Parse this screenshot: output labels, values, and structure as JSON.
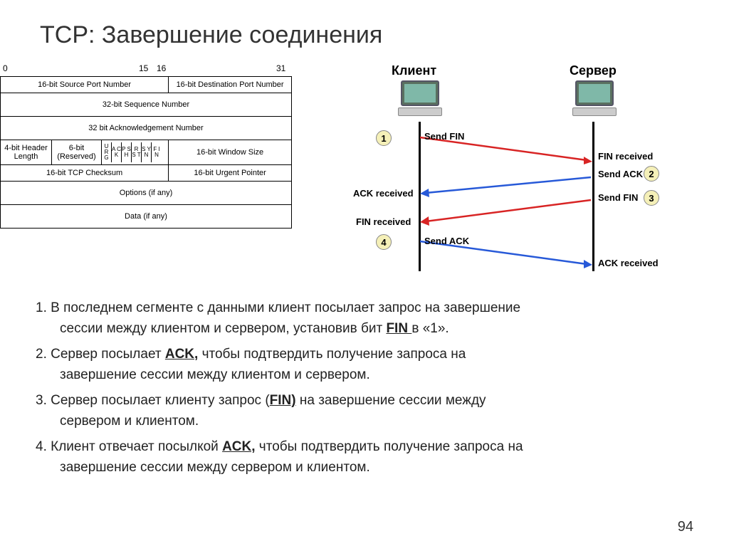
{
  "title": "TCP: Завершение соединения",
  "bits": {
    "b0": "0",
    "b15": "15",
    "b16": "16",
    "b31": "31"
  },
  "header": {
    "srcport": "16-bit Source Port Number",
    "dstport": "16-bit Destination Port Number",
    "seq": "32-bit Sequence Number",
    "ack": "32 bit Acknowledgement Number",
    "hlen": "4-bit Header Length",
    "reserved": "6-bit (Reserved)",
    "flags": [
      "U R G",
      "A C K",
      "P S H",
      "R S T",
      "S Y N",
      "F I N"
    ],
    "win": "16-bit Window Size",
    "cksum": "16-bit TCP Checksum",
    "urg": "16-bit Urgent Pointer",
    "opts": "Options (if any)",
    "data": "Data (if any)"
  },
  "diagram": {
    "client": "Клиент",
    "server": "Сервер",
    "s1": "1",
    "s2": "2",
    "s3": "3",
    "s4": "4",
    "sendfin": "Send FIN",
    "finrecv": "FIN received",
    "sendack": "Send ACK",
    "ackrecv": "ACK received",
    "finrecv2": "FIN received",
    "sendfin2": "Send FIN",
    "sendack2": "Send ACK",
    "ackrecv2": "ACK received"
  },
  "bullets": {
    "l1a": "1. В последнем сегменте с данными  клиент посылает запрос  на завершение",
    "l1b": "сессии между клиентом и сервером, установив бит ",
    "l1c": "FIN ",
    "l1d": " в «1».",
    "l2a": "2. Сервер посылает ",
    "l2b": "ACK,",
    "l2c": " чтобы подтвердить получение запроса на",
    "l2d": "завершение сессии между клиентом и сервером.",
    "l3a": "3. Сервер посылает клиенту  запрос (",
    "l3b": "FIN)",
    "l3c": " на завершение сессии между",
    "l3d": "сервером и клиентом.",
    "l4a": "4. Клиент отвечает посылкой ",
    "l4b": "ACK,",
    "l4c": " чтобы подтвердить получение запроса на",
    "l4d": "завершение сессии между сервером и клиентом."
  },
  "pagenum": "94"
}
